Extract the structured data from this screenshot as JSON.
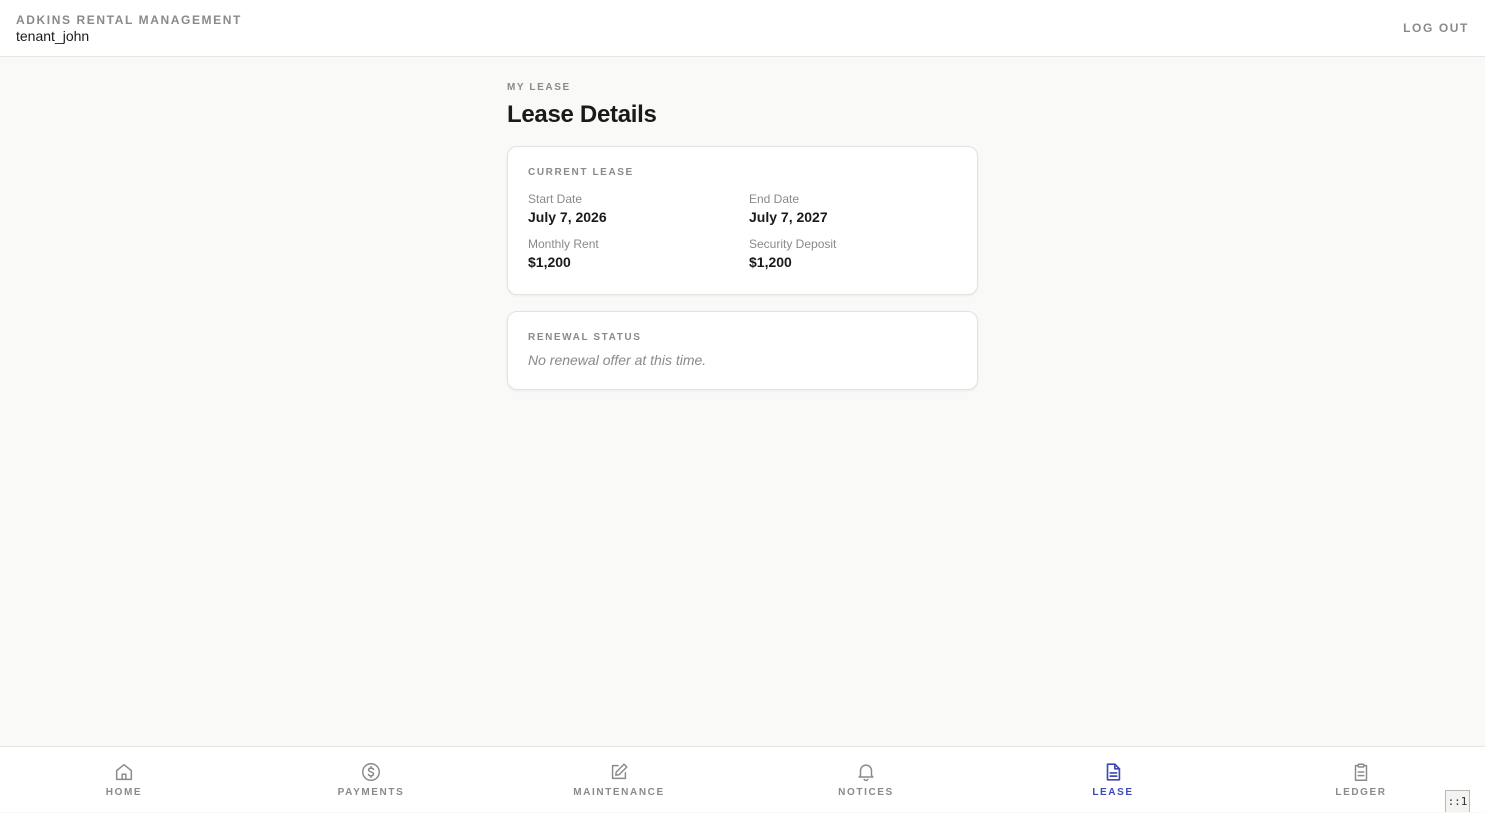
{
  "header": {
    "brand": "ADKINS RENTAL MANAGEMENT",
    "username": "tenant_john",
    "logout_label": "LOG OUT"
  },
  "page": {
    "eyebrow": "MY LEASE",
    "title": "Lease Details"
  },
  "current_lease": {
    "label": "CURRENT LEASE",
    "start_date_label": "Start Date",
    "start_date": "July 7, 2026",
    "end_date_label": "End Date",
    "end_date": "July 7, 2027",
    "monthly_rent_label": "Monthly Rent",
    "monthly_rent": "$1,200",
    "security_deposit_label": "Security Deposit",
    "security_deposit": "$1,200"
  },
  "renewal": {
    "label": "RENEWAL STATUS",
    "text": "No renewal offer at this time."
  },
  "nav": {
    "items": [
      {
        "label": "HOME",
        "icon": "home-icon"
      },
      {
        "label": "PAYMENTS",
        "icon": "dollar-circle-icon"
      },
      {
        "label": "MAINTENANCE",
        "icon": "edit-icon"
      },
      {
        "label": "NOTICES",
        "icon": "bell-icon"
      },
      {
        "label": "LEASE",
        "icon": "document-icon",
        "active": true
      },
      {
        "label": "LEDGER",
        "icon": "clipboard-icon"
      }
    ]
  },
  "corner_tag": "::1",
  "colors": {
    "accent": "#3b48b8",
    "muted": "#8a8a87",
    "background": "#f9f9f8"
  }
}
